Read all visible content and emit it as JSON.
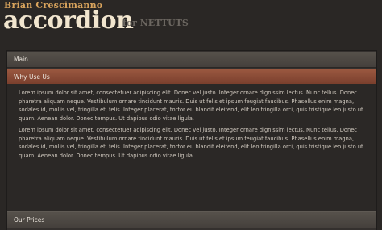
{
  "header": {
    "author": "Brian Crescimanno",
    "title": "accordion",
    "subtitle": "for NETTUTS"
  },
  "accordion": {
    "sections": [
      {
        "label": "Main"
      },
      {
        "label": "Why Use Us"
      },
      {
        "label": "Our Prices"
      }
    ],
    "active_index": 1,
    "paragraphs": [
      "Lorem ipsum dolor sit amet, consectetuer adipiscing elit. Donec vel justo. Integer ornare dignissim lectus. Nunc tellus. Donec pharetra aliquam neque. Vestibulum ornare tincidunt mauris. Duis ut felis et ipsum feugiat faucibus. Phasellus enim magna, sodales id, mollis vel, fringilla et, felis. Integer placerat, tortor eu blandit eleifend, elit leo fringilla orci, quis tristique leo justo ut quam. Aenean dolor. Donec tempus. Ut dapibus odio vitae ligula.",
      "Lorem ipsum dolor sit amet, consectetuer adipiscing elit. Donec vel justo. Integer ornare dignissim lectus. Nunc tellus. Donec pharetra aliquam neque. Vestibulum ornare tincidunt mauris. Duis ut felis et ipsum feugiat faucibus. Phasellus enim magna, sodales id, mollis vel, fringilla et, felis. Integer placerat, tortor eu blandit eleifend, elit leo fringilla orci, quis tristique leo justo ut quam. Aenean dolor. Donec tempus. Ut dapibus odio vitae ligula."
    ]
  },
  "colors": {
    "background": "#2a2725",
    "title": "#f2e6cf",
    "author": "#d9a45d",
    "active_header": "#8a4a35",
    "inactive_header": "#4f4a45"
  }
}
